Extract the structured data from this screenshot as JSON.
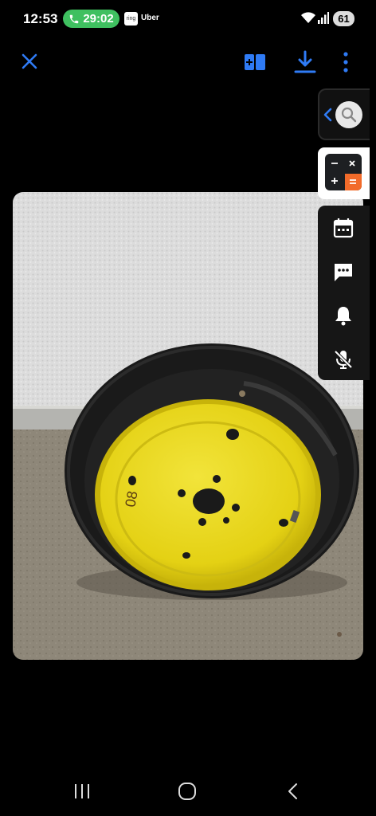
{
  "status_bar": {
    "time": "12:53",
    "call_duration": "29:02",
    "app_badge": "ring",
    "app_label": "Uber",
    "battery": "61"
  },
  "toolbar": {
    "close_icon": "close-icon",
    "add_icon": "add-to-gallery-icon",
    "download_icon": "download-icon",
    "more_icon": "more-vertical-icon",
    "accent": "#2f7bf5"
  },
  "photo": {
    "subject": "spare tire with yellow steel rim",
    "rim_marking": "08"
  },
  "edge_panel": {
    "handle_icons": [
      "chevron-left-icon",
      "search-icon"
    ],
    "apps": [
      "calculator-icon"
    ],
    "tools": [
      "calendar-icon",
      "message-icon",
      "bell-icon",
      "mic-off-icon"
    ],
    "calculator_accent": "#f26b2a"
  },
  "nav_bar": {
    "items": [
      "recents-icon",
      "home-icon",
      "back-icon"
    ]
  }
}
